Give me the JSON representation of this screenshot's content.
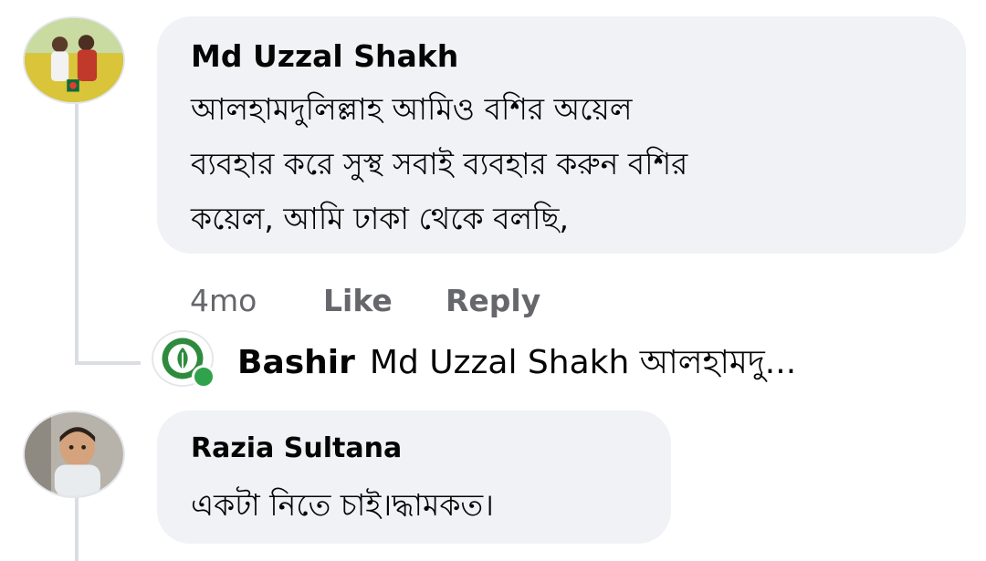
{
  "comments": [
    {
      "author": "Md Uzzal Shakh",
      "lines": [
        "আলহামদুলিল্লাহ আমিও বশির অয়েল",
        "ব্যবহার করে সুস্থ সবাই ব্যবহার করুন বশির",
        "কয়েল, আমি ঢাকা থেকে বলছি,"
      ],
      "time": "4mo",
      "like_label": "Like",
      "reply_label": "Reply"
    },
    {
      "author": "Razia Sultana",
      "lines": [
        "একটা নিতে চাই।দ্ধামকত।"
      ]
    }
  ],
  "reply_preview": {
    "author": "Bashir",
    "text": "Md Uzzal Shakh আলহামদু..."
  },
  "colors": {
    "bubble_bg": "#f0f2f5",
    "text_primary": "#050505",
    "text_secondary": "#65676b",
    "online": "#31a24c",
    "brand_green": "#2e8b3e"
  }
}
